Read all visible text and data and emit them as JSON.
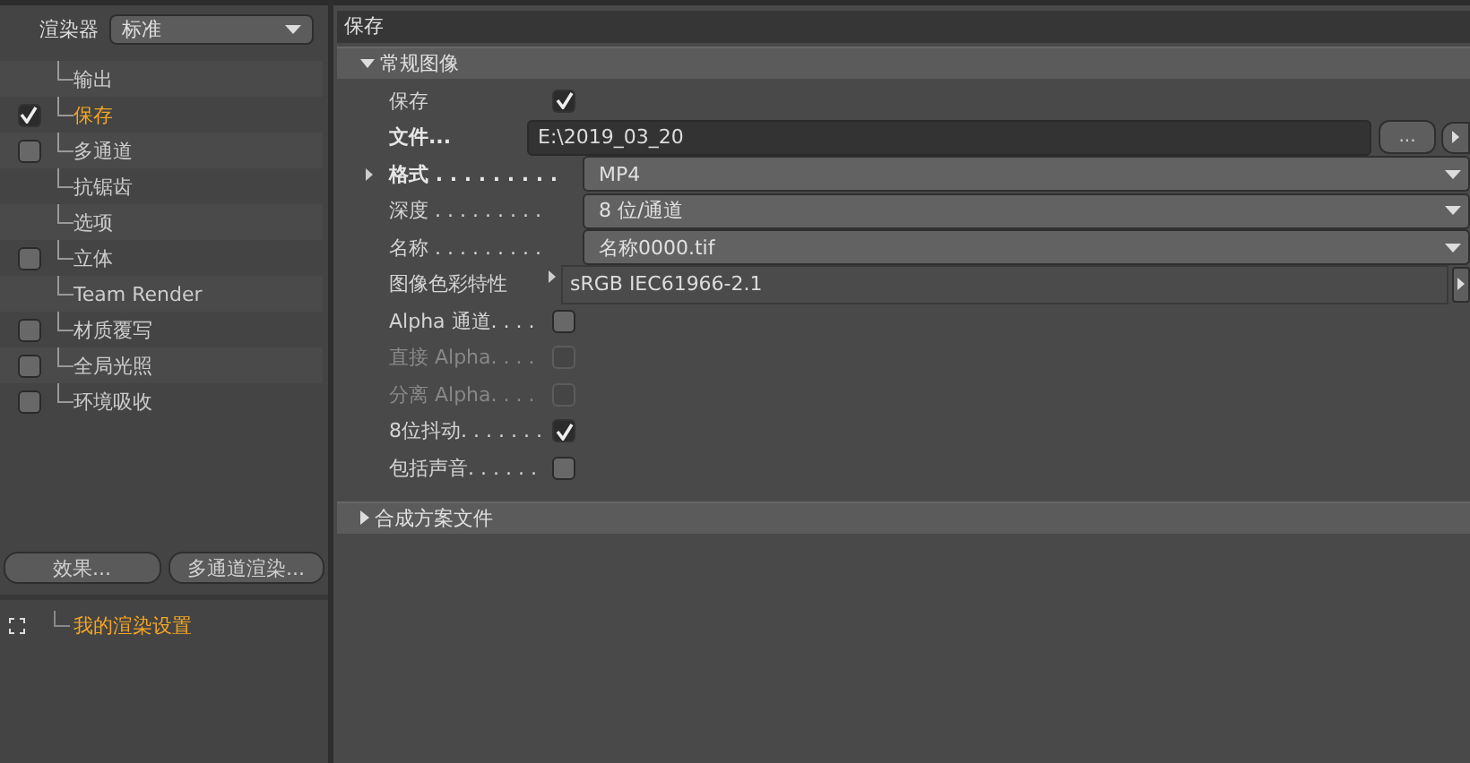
{
  "renderer": {
    "label": "渲染器",
    "value": "标准"
  },
  "tree": [
    {
      "label": "输出",
      "selected": false
    },
    {
      "label": "保存",
      "checked": true,
      "selected": true
    },
    {
      "label": "多通道",
      "checked": false,
      "selected": false
    },
    {
      "label": "抗锯齿",
      "selected": false
    },
    {
      "label": "选项",
      "selected": false
    },
    {
      "label": "立体",
      "checked": false,
      "selected": false
    },
    {
      "label": "Team Render",
      "selected": false
    },
    {
      "label": "材质覆写",
      "checked": false,
      "selected": false
    },
    {
      "label": "全局光照",
      "checked": false,
      "selected": false
    },
    {
      "label": "环境吸收",
      "checked": false,
      "selected": false
    }
  ],
  "buttons": [
    "效果...",
    "多通道渲染..."
  ],
  "settings_list": [
    {
      "label": "我的渲染设置",
      "selected": true
    }
  ],
  "panel_title": "保存",
  "sections": [
    {
      "title": "常规图像",
      "expanded": true,
      "rows": [
        {
          "kind": "checkbox",
          "label": "保存",
          "checked": true,
          "disabled": false
        },
        {
          "kind": "file",
          "label": "文件...",
          "value": "E:\\2019_03_20",
          "button": "..."
        },
        {
          "kind": "dropdown",
          "label": "格式",
          "dots": ". . . . . . . . .",
          "value": "MP4",
          "has_arrow": true
        },
        {
          "kind": "dropdown",
          "label": "深度",
          "dots": ". . . . . . . . .",
          "value": "8 位/通道",
          "has_arrow": false
        },
        {
          "kind": "dropdown",
          "label": "名称",
          "dots": ". . . . . . . . .",
          "value": "名称0000.tif",
          "has_arrow": false
        },
        {
          "kind": "profile",
          "label": "图像色彩特性",
          "value": "sRGB IEC61966-2.1"
        },
        {
          "kind": "checkbox",
          "label": "Alpha 通道",
          "dots": ". . . .",
          "checked": false,
          "disabled": false
        },
        {
          "kind": "checkbox",
          "label": "直接 Alpha",
          "dots": ". . . .",
          "checked": false,
          "disabled": true
        },
        {
          "kind": "checkbox",
          "label": "分离 Alpha",
          "dots": ". . . .",
          "checked": false,
          "disabled": true
        },
        {
          "kind": "checkbox",
          "label": "8位抖动",
          "dots": ". . . . . . .",
          "checked": true,
          "disabled": false
        },
        {
          "kind": "checkbox",
          "label": "包括声音",
          "dots": ". . . . . .",
          "checked": false,
          "disabled": false
        }
      ]
    },
    {
      "title": "合成方案文件",
      "expanded": false
    }
  ]
}
